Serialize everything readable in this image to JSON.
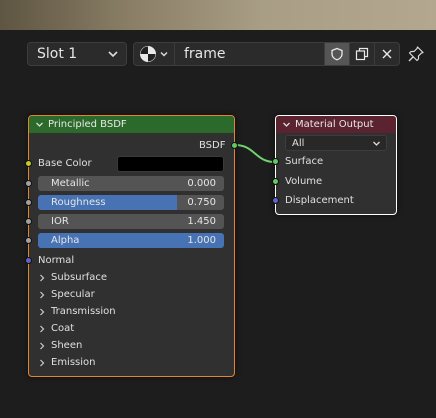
{
  "header": {
    "slot_label": "Slot 1",
    "material_name": "frame",
    "icons": [
      "chevron-down-icon",
      "material-sphere-icon",
      "fake-user-shield-icon",
      "duplicate-icon",
      "close-icon",
      "pin-icon"
    ]
  },
  "bsdf_node": {
    "title": "Principled BSDF",
    "output": "BSDF",
    "base_color_label": "Base Color",
    "base_color": "#000000",
    "fields": [
      {
        "label": "Metallic",
        "value": "0.000",
        "fill": 0.0
      },
      {
        "label": "Roughness",
        "value": "0.750",
        "fill": 0.75
      },
      {
        "label": "IOR",
        "value": "1.450",
        "fill": 0.0
      },
      {
        "label": "Alpha",
        "value": "1.000",
        "fill": 1.0
      }
    ],
    "normal_label": "Normal",
    "panels": [
      "Subsurface",
      "Specular",
      "Transmission",
      "Coat",
      "Sheen",
      "Emission"
    ]
  },
  "output_node": {
    "title": "Material Output",
    "target": "All",
    "inputs": [
      "Surface",
      "Volume",
      "Displacement"
    ]
  },
  "colors": {
    "shader_socket": "#63c763",
    "color_socket": "#c7c729",
    "value_socket": "#a1a1a1",
    "vector_socket": "#6363c7",
    "bsdf_header": "#2c6a2c",
    "output_header": "#5b2230",
    "slider_fill": "#4772b3",
    "selected_outline": "#e4842f"
  }
}
